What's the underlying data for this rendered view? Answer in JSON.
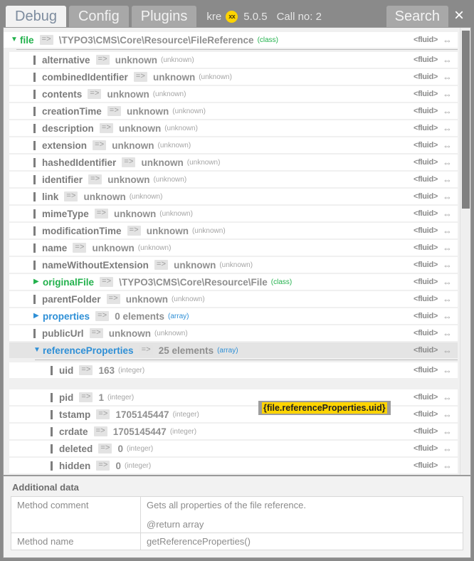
{
  "header": {
    "tabs": [
      {
        "label": "Debug",
        "active": true
      },
      {
        "label": "Config",
        "active": false
      },
      {
        "label": "Plugins",
        "active": false
      }
    ],
    "brand_name": "kre",
    "brand_badge": "xx",
    "version": "5.0.5",
    "call_no": "Call no: 2",
    "search_label": "Search",
    "close_label": "×"
  },
  "labels": {
    "fluid": "<fluid>",
    "copy_icon": "⇔",
    "arrow": "=>",
    "toggle_open": "▼",
    "toggle_closed": "▶"
  },
  "tree": [
    {
      "level": 0,
      "state": "open",
      "color": "green",
      "key": "file",
      "value": "\\TYPO3\\CMS\\Core\\Resource\\FileReference",
      "type": "(class)",
      "type_color": "green",
      "divider_after": true
    },
    {
      "level": 1,
      "state": "leaf",
      "color": "gray",
      "key": "alternative",
      "value": "unknown",
      "type": "(unknown)",
      "type_color": "gray"
    },
    {
      "level": 1,
      "state": "leaf",
      "color": "gray",
      "key": "combinedIdentifier",
      "value": "unknown",
      "type": "(unknown)",
      "type_color": "gray"
    },
    {
      "level": 1,
      "state": "leaf",
      "color": "gray",
      "key": "contents",
      "value": "unknown",
      "type": "(unknown)",
      "type_color": "gray"
    },
    {
      "level": 1,
      "state": "leaf",
      "color": "gray",
      "key": "creationTime",
      "value": "unknown",
      "type": "(unknown)",
      "type_color": "gray"
    },
    {
      "level": 1,
      "state": "leaf",
      "color": "gray",
      "key": "description",
      "value": "unknown",
      "type": "(unknown)",
      "type_color": "gray"
    },
    {
      "level": 1,
      "state": "leaf",
      "color": "gray",
      "key": "extension",
      "value": "unknown",
      "type": "(unknown)",
      "type_color": "gray"
    },
    {
      "level": 1,
      "state": "leaf",
      "color": "gray",
      "key": "hashedIdentifier",
      "value": "unknown",
      "type": "(unknown)",
      "type_color": "gray"
    },
    {
      "level": 1,
      "state": "leaf",
      "color": "gray",
      "key": "identifier",
      "value": "unknown",
      "type": "(unknown)",
      "type_color": "gray"
    },
    {
      "level": 1,
      "state": "leaf",
      "color": "gray",
      "key": "link",
      "value": "unknown",
      "type": "(unknown)",
      "type_color": "gray"
    },
    {
      "level": 1,
      "state": "leaf",
      "color": "gray",
      "key": "mimeType",
      "value": "unknown",
      "type": "(unknown)",
      "type_color": "gray"
    },
    {
      "level": 1,
      "state": "leaf",
      "color": "gray",
      "key": "modificationTime",
      "value": "unknown",
      "type": "(unknown)",
      "type_color": "gray"
    },
    {
      "level": 1,
      "state": "leaf",
      "color": "gray",
      "key": "name",
      "value": "unknown",
      "type": "(unknown)",
      "type_color": "gray"
    },
    {
      "level": 1,
      "state": "leaf",
      "color": "gray",
      "key": "nameWithoutExtension",
      "value": "unknown",
      "type": "(unknown)",
      "type_color": "gray"
    },
    {
      "level": 1,
      "state": "closed",
      "color": "green",
      "key": "originalFile",
      "value": "\\TYPO3\\CMS\\Core\\Resource\\File",
      "type": "(class)",
      "type_color": "green"
    },
    {
      "level": 1,
      "state": "leaf",
      "color": "gray",
      "key": "parentFolder",
      "value": "unknown",
      "type": "(unknown)",
      "type_color": "gray"
    },
    {
      "level": 1,
      "state": "closed",
      "color": "blue",
      "key": "properties",
      "value": "0 elements",
      "type": "(array)",
      "type_color": "blue"
    },
    {
      "level": 1,
      "state": "leaf",
      "color": "gray",
      "key": "publicUrl",
      "value": "unknown",
      "type": "(unknown)",
      "type_color": "gray"
    },
    {
      "level": 1,
      "state": "open",
      "color": "blue",
      "key": "referenceProperties",
      "value": "25 elements",
      "type": "(array)",
      "type_color": "blue",
      "highlight": true,
      "divider_after": true
    },
    {
      "level": 2,
      "state": "leaf",
      "color": "gray",
      "key": "uid",
      "value": "163",
      "type": "(integer)",
      "type_color": "gray",
      "gap_after": true
    },
    {
      "level": 2,
      "state": "leaf",
      "color": "gray",
      "key": "pid",
      "value": "1",
      "type": "(integer)",
      "type_color": "gray"
    },
    {
      "level": 2,
      "state": "leaf",
      "color": "gray",
      "key": "tstamp",
      "value": "1705145447",
      "type": "(integer)",
      "type_color": "gray"
    },
    {
      "level": 2,
      "state": "leaf",
      "color": "gray",
      "key": "crdate",
      "value": "1705145447",
      "type": "(integer)",
      "type_color": "gray"
    },
    {
      "level": 2,
      "state": "leaf",
      "color": "gray",
      "key": "deleted",
      "value": "0",
      "type": "(integer)",
      "type_color": "gray"
    },
    {
      "level": 2,
      "state": "leaf",
      "color": "gray",
      "key": "hidden",
      "value": "0",
      "type": "(integer)",
      "type_color": "gray"
    }
  ],
  "tooltip": {
    "text": "{file.referenceProperties.uid}"
  },
  "additional": {
    "title": "Additional data",
    "rows": [
      {
        "label": "Method comment",
        "lines": [
          "Gets all properties of the file reference.",
          "@return array"
        ]
      },
      {
        "label": "Method name",
        "lines": [
          "getReferenceProperties()"
        ]
      }
    ]
  },
  "colors": {
    "chrome": "#8a8a8a",
    "accent_green": "#22b14c",
    "accent_blue": "#2e8fd6",
    "badge_yellow": "#ffd400",
    "text_gray": "#8b8b8b"
  }
}
